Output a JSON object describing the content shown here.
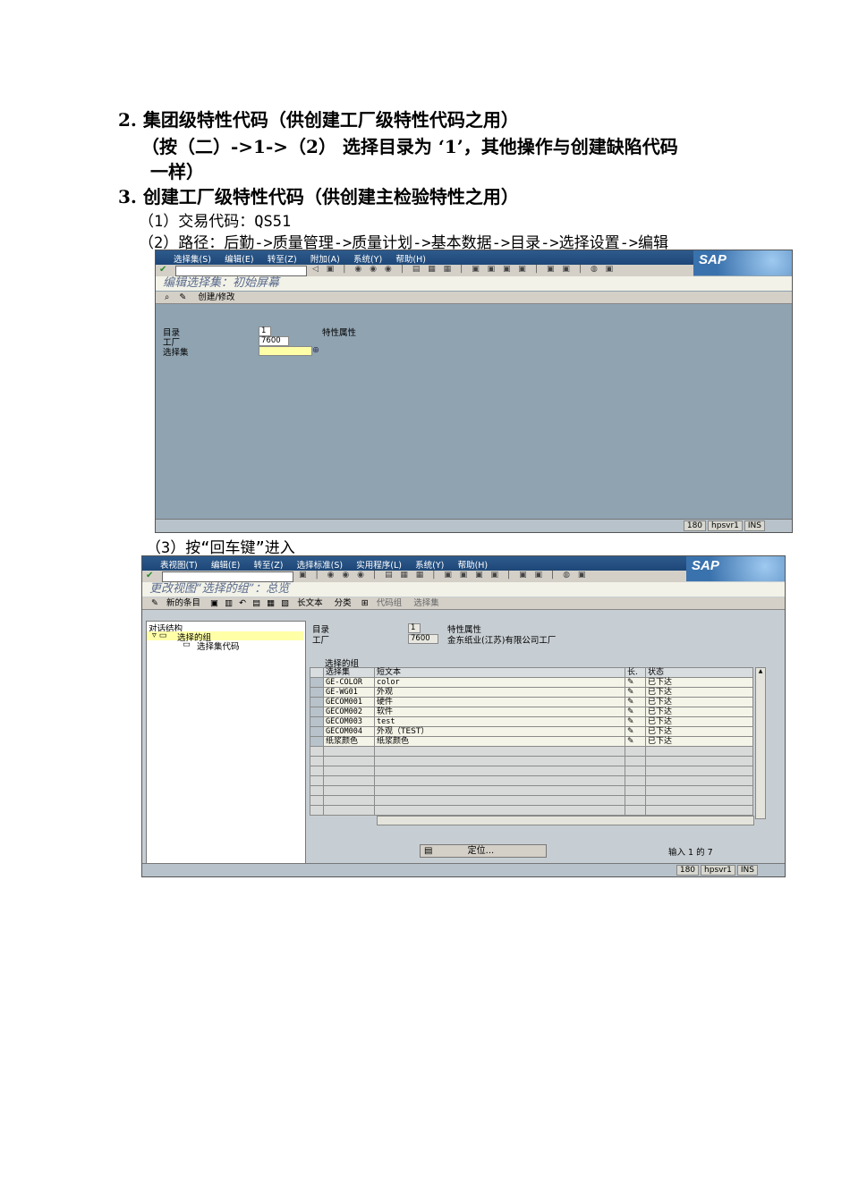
{
  "doc": {
    "h2": "2. 集团级特性代码（供创建工厂级特性代码之用）",
    "h2_line2": "（按（二）->1->（2） 选择目录为 ‘1’，其他操作与创建缺陷代码",
    "h2_line3": "一样）",
    "h3": "3. 创建工厂级特性代码（供创建主检验特性之用）",
    "s1": "（1）交易代码：QS51",
    "s2": "（2）路径：后勤->质量管理->质量计划->基本数据->目录->选择设置->编辑",
    "s3": "（3）按“回车键”进入"
  },
  "win1": {
    "menu": [
      "选择集(S)",
      "编辑(E)",
      "转至(Z)",
      "附加(A)",
      "系统(Y)",
      "帮助(H)"
    ],
    "logo": "SAP",
    "title": "编辑选择集：初始屏幕",
    "app_toolbar": "创建/修改",
    "fields": {
      "catalog_label": "目录",
      "catalog_value": "1",
      "catalog_desc": "特性属性",
      "plant_label": "工厂",
      "plant_value": "7600",
      "selset_label": "选择集",
      "selset_value": ""
    },
    "status": [
      "180",
      "hpsvr1",
      "INS"
    ]
  },
  "win2": {
    "menu": [
      "表视图(T)",
      "编辑(E)",
      "转至(Z)",
      "选择标准(S)",
      "实用程序(L)",
      "系统(Y)",
      "帮助(H)"
    ],
    "logo": "SAP",
    "title": "更改视图“选择的组”：总览",
    "app_toolbar": [
      "新的条目",
      "长文本",
      "分类",
      "代码组",
      "选择集"
    ],
    "tree": {
      "root": "对话结构",
      "node1": "选择的组",
      "node2": "选择集代码"
    },
    "fields": {
      "catalog_label": "目录",
      "catalog_value": "1",
      "catalog_desc": "特性属性",
      "plant_label": "工厂",
      "plant_value": "7600",
      "plant_desc": "金东纸业(江苏)有限公司工厂"
    },
    "table": {
      "caption": "选择的组",
      "headers": [
        "选择集",
        "短文本",
        "长.",
        "状态"
      ],
      "rows": [
        [
          "GE-COLOR",
          "color",
          "已下达"
        ],
        [
          "GE-WG01",
          "外观",
          "已下达"
        ],
        [
          "GECOM001",
          "硬件",
          "已下达"
        ],
        [
          "GECOM002",
          "软件",
          "已下达"
        ],
        [
          "GECOM003",
          "test",
          "已下达"
        ],
        [
          "GECOM004",
          "外观（TEST）",
          "已下达"
        ],
        [
          "纸浆颜色",
          "纸浆颜色",
          "已下达"
        ]
      ]
    },
    "locate_button": "定位...",
    "entry_info": "输入 1 的 7",
    "status": [
      "180",
      "hpsvr1",
      "INS"
    ]
  }
}
